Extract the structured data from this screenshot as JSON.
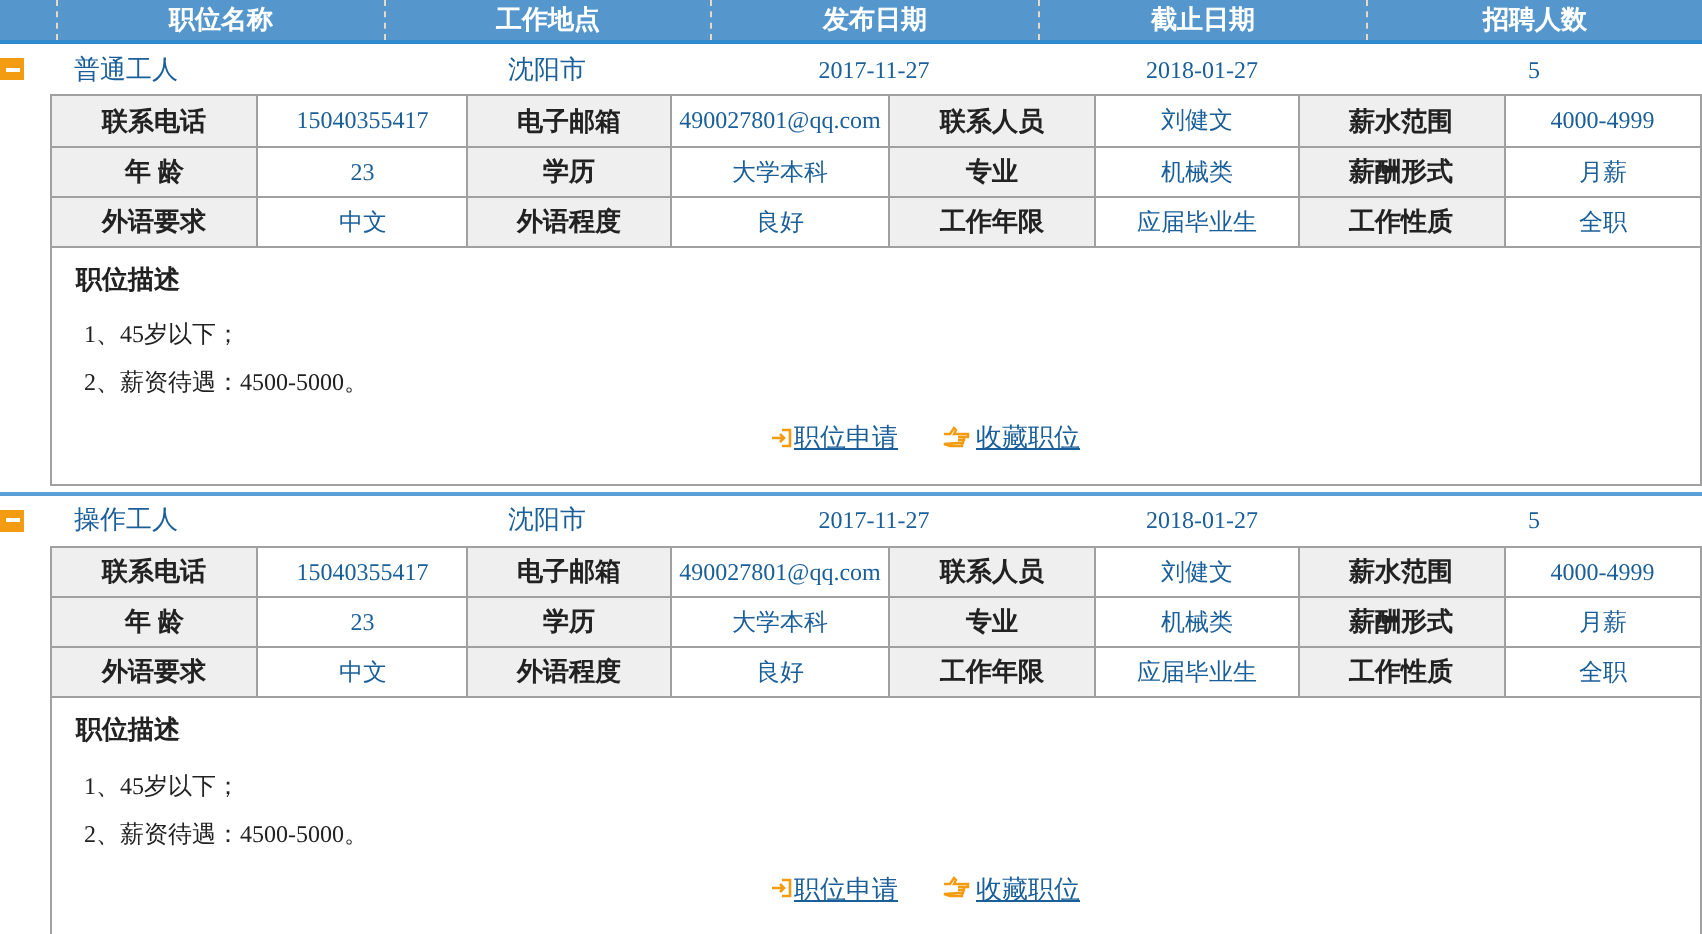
{
  "header": {
    "columns": [
      "职位名称",
      "工作地点",
      "发布日期",
      "截止日期",
      "招聘人数"
    ]
  },
  "jobs": [
    {
      "expanded": true,
      "title": "普通工人",
      "location": "沈阳市",
      "published": "2017-11-27",
      "deadline": "2018-01-27",
      "openings": "5",
      "details": [
        [
          {
            "label": "联系电话",
            "value": "15040355417"
          },
          {
            "label": "电子邮箱",
            "value": "490027801@qq.com"
          },
          {
            "label": "联系人员",
            "value": "刘健文"
          },
          {
            "label": "薪水范围",
            "value": "4000-4999"
          }
        ],
        [
          {
            "label": "年 龄",
            "value": "23"
          },
          {
            "label": "学历",
            "value": "大学本科"
          },
          {
            "label": "专业",
            "value": "机械类"
          },
          {
            "label": "薪酬形式",
            "value": "月薪"
          }
        ],
        [
          {
            "label": "外语要求",
            "value": "中文"
          },
          {
            "label": "外语程度",
            "value": "良好"
          },
          {
            "label": "工作年限",
            "value": "应届毕业生"
          },
          {
            "label": "工作性质",
            "value": "全职"
          }
        ]
      ],
      "description_title": "职位描述",
      "description": [
        "1、45岁以下；",
        "2、薪资待遇：4500-5000。"
      ],
      "apply_link": "职位申请",
      "save_link": "收藏职位"
    },
    {
      "expanded": true,
      "title": "操作工人",
      "location": "沈阳市",
      "published": "2017-11-27",
      "deadline": "2018-01-27",
      "openings": "5",
      "details": [
        [
          {
            "label": "联系电话",
            "value": "15040355417"
          },
          {
            "label": "电子邮箱",
            "value": "490027801@qq.com"
          },
          {
            "label": "联系人员",
            "value": "刘健文"
          },
          {
            "label": "薪水范围",
            "value": "4000-4999"
          }
        ],
        [
          {
            "label": "年 龄",
            "value": "23"
          },
          {
            "label": "学历",
            "value": "大学本科"
          },
          {
            "label": "专业",
            "value": "机械类"
          },
          {
            "label": "薪酬形式",
            "value": "月薪"
          }
        ],
        [
          {
            "label": "外语要求",
            "value": "中文"
          },
          {
            "label": "外语程度",
            "value": "良好"
          },
          {
            "label": "工作年限",
            "value": "应届毕业生"
          },
          {
            "label": "工作性质",
            "value": "全职"
          }
        ]
      ],
      "description_title": "职位描述",
      "description": [
        "1、45岁以下；",
        "2、薪资待遇：4500-5000。"
      ],
      "apply_link": "职位申请",
      "save_link": "收藏职位"
    }
  ]
}
